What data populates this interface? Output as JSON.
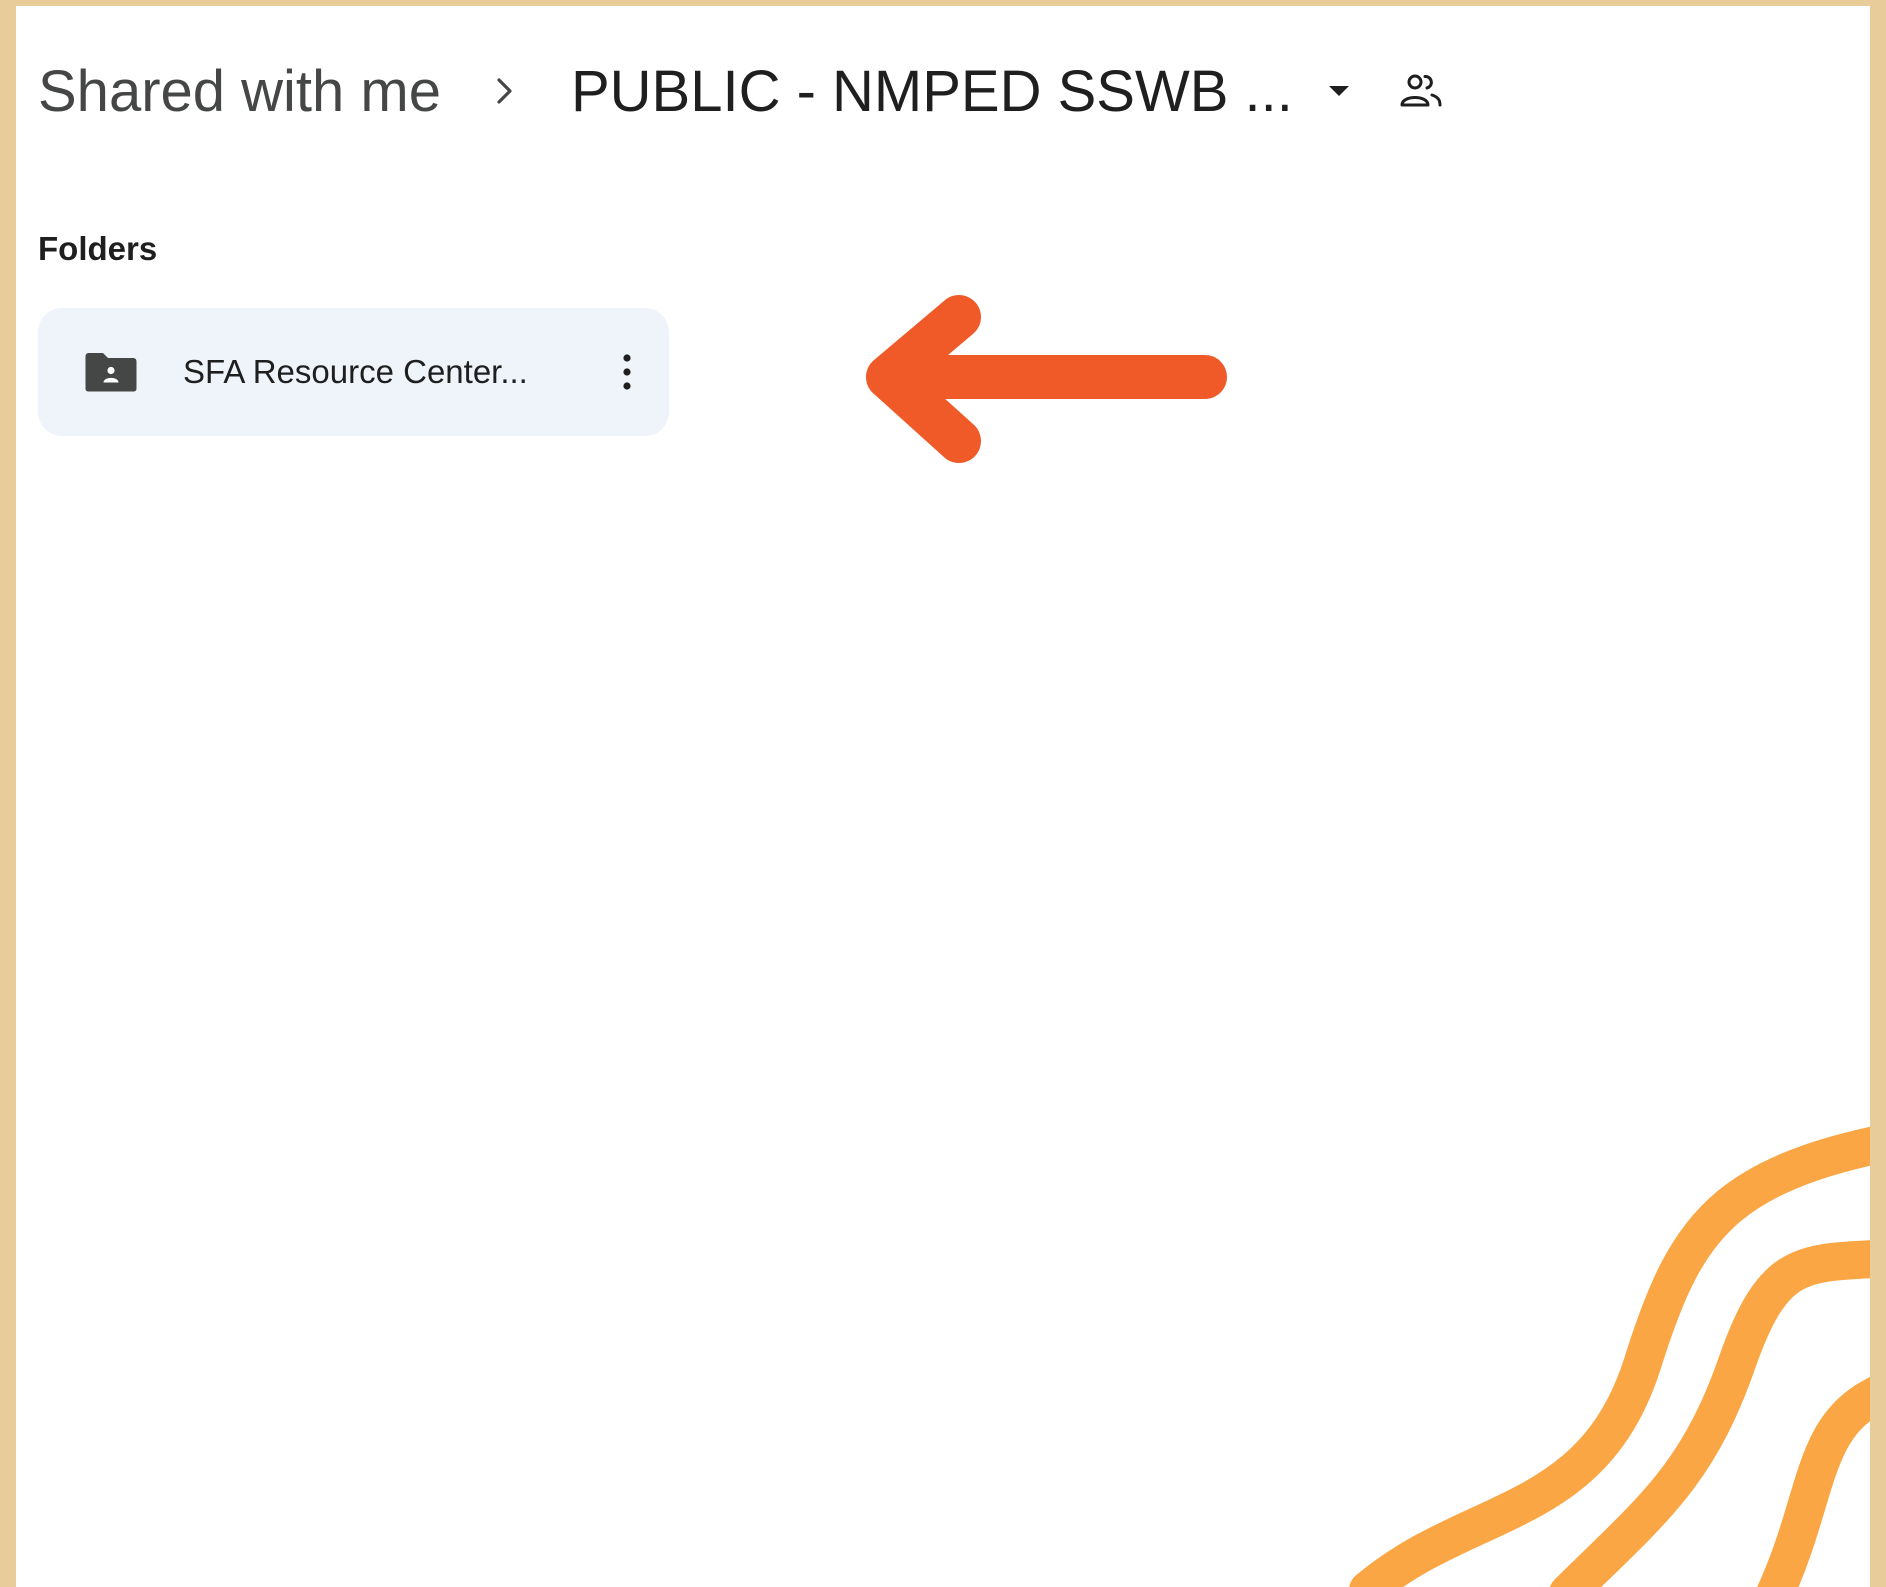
{
  "breadcrumb": {
    "parent": "Shared with me",
    "current": "PUBLIC - NMPED SSWB ..."
  },
  "folders_section": {
    "title": "Folders",
    "items": [
      {
        "name": "SFA Resource Center..."
      }
    ]
  },
  "icons": {
    "separator": "chevron-right-icon",
    "dropdown": "arrow-drop-down-icon",
    "shared": "people-icon",
    "folder": "shared-folder-icon",
    "more": "more-vert-icon"
  },
  "colors": {
    "frame_background": "#e8cd9b",
    "panel_background": "#ffffff",
    "folder_card": "#eff3fa",
    "annotation_arrow": "#f05a28",
    "decoration_waves": "#fba644"
  }
}
